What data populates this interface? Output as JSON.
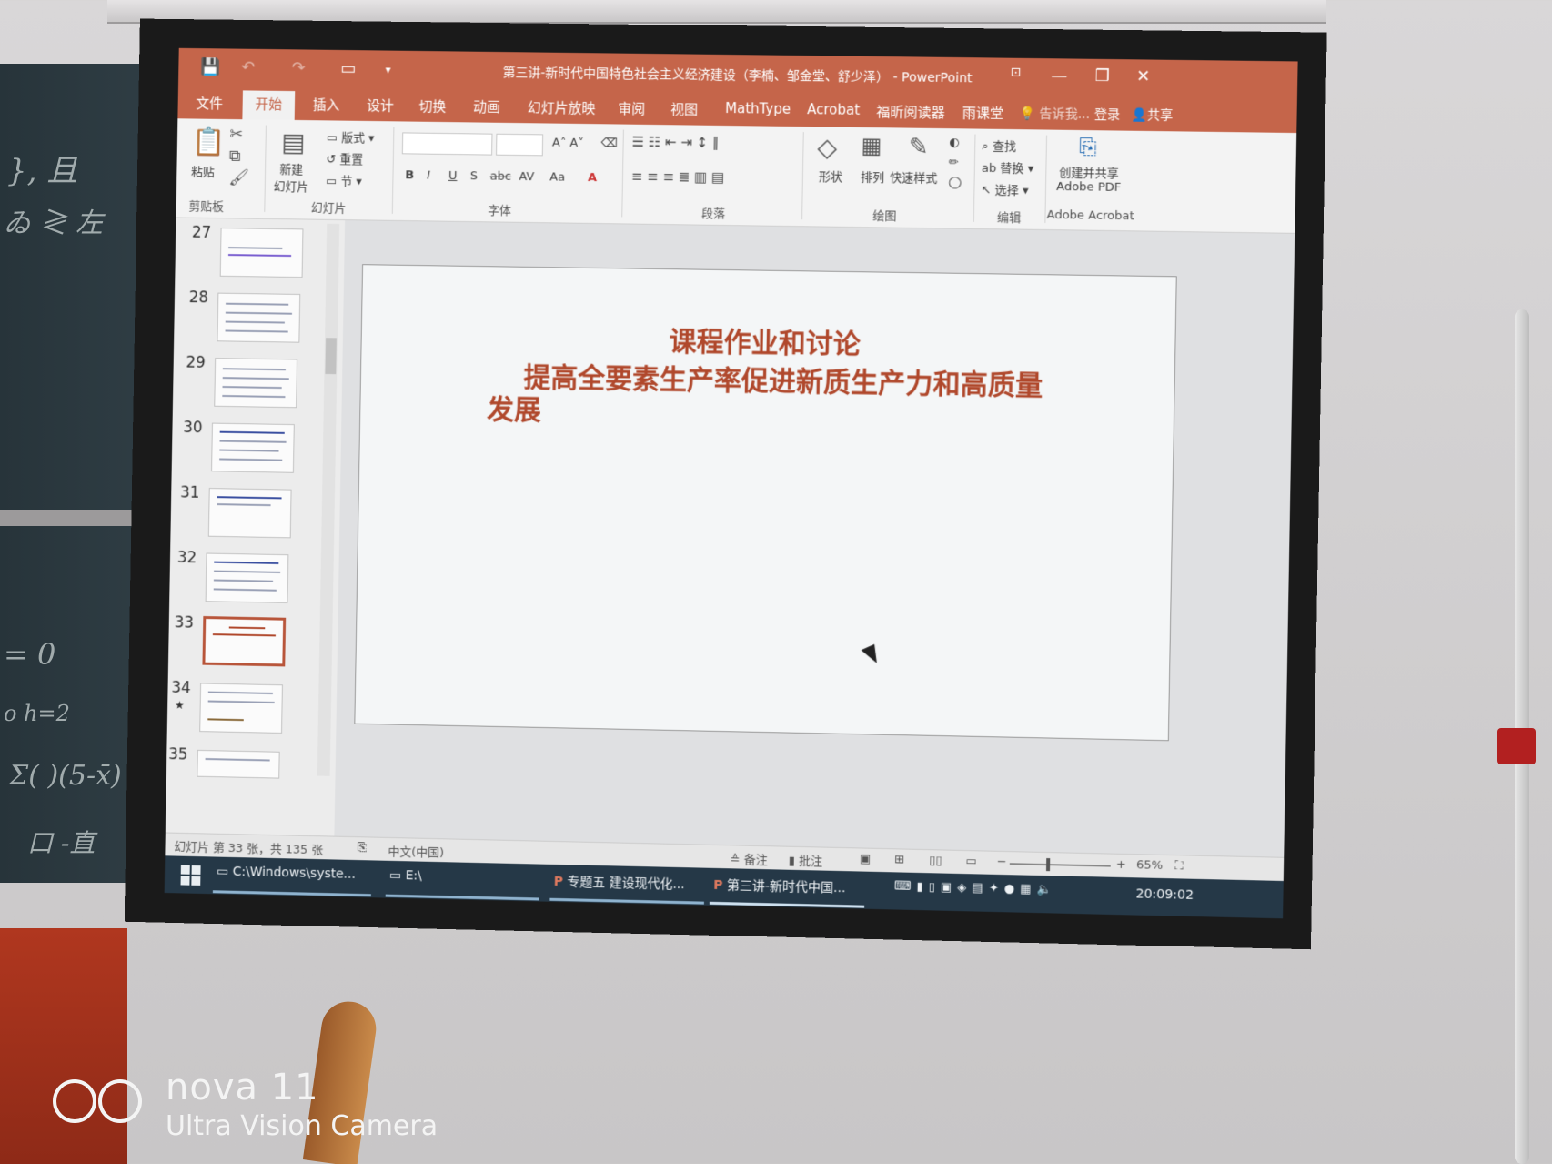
{
  "window": {
    "title": "第三讲-新时代中国特色社会主义经济建设（李楠、邹金堂、舒少泽） - PowerPoint",
    "controls": [
      "—",
      "❐",
      "✕"
    ]
  },
  "ribbon_tabs": [
    "文件",
    "开始",
    "插入",
    "设计",
    "切换",
    "动画",
    "幻灯片放映",
    "审阅",
    "视图",
    "MathType",
    "Acrobat",
    "福昕阅读器",
    "雨课堂"
  ],
  "tab_right": {
    "tell_me": "告诉我...",
    "login": "登录",
    "share": "共享"
  },
  "ribbon": {
    "clipboard": {
      "paste": "粘贴",
      "group": "剪贴板"
    },
    "slides": {
      "new_slide": "新建\n幻灯片",
      "layout": "版式",
      "reset": "重置",
      "section": "节",
      "group": "幻灯片"
    },
    "font": {
      "bold": "B",
      "italic": "I",
      "underline": "U",
      "shadow": "S",
      "strike": "abc",
      "spacing": "AV",
      "case": "Aa",
      "group": "字体"
    },
    "paragraph": {
      "group": "段落"
    },
    "drawing": {
      "shape": "形状",
      "arrange": "排列",
      "quick_styles": "快速样式",
      "group": "绘图"
    },
    "editing": {
      "find": "查找",
      "replace": "替换",
      "select": "选择",
      "group": "编辑"
    },
    "acrobat": {
      "create": "创建并共享\nAdobe PDF",
      "group": "Adobe Acrobat"
    }
  },
  "thumbnails": [
    {
      "num": "27",
      "selected": false
    },
    {
      "num": "28",
      "selected": false
    },
    {
      "num": "29",
      "selected": false
    },
    {
      "num": "30",
      "selected": false
    },
    {
      "num": "31",
      "selected": false
    },
    {
      "num": "32",
      "selected": false
    },
    {
      "num": "33",
      "selected": true
    },
    {
      "num": "34",
      "selected": false
    },
    {
      "num": "35",
      "selected": false
    }
  ],
  "slide": {
    "line1": "课程作业和讨论",
    "line2": "提高全要素生产率促进新质生产力和高质量发展"
  },
  "status": {
    "slide_info": "幻灯片 第 33 张，共 135 张",
    "language": "中文(中国)",
    "notes": "备注",
    "comments": "批注",
    "zoom": "65%"
  },
  "taskbar": {
    "items": [
      "C:\\Windows\\syste...",
      "E:\\",
      "专题五 建设现代化...",
      "第三讲-新时代中国..."
    ],
    "clock": "20:09:02"
  },
  "camera_watermark": {
    "brand": "nova 11",
    "sub": "Ultra Vision Camera"
  },
  "colors": {
    "accent": "#c5654a",
    "slide_title": "#b0482c",
    "taskbar": "#253847"
  }
}
